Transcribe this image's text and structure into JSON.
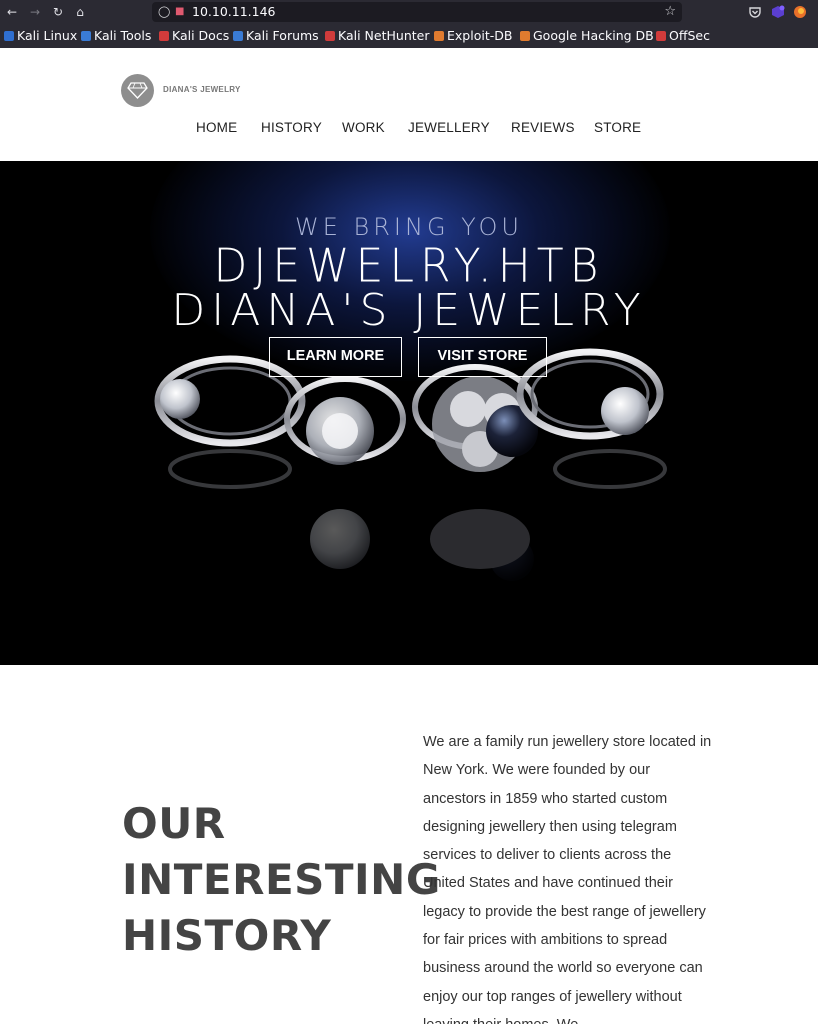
{
  "browser": {
    "url": "10.10.11.146",
    "bookmarks": [
      {
        "label": "Kali Linux",
        "color": "#2f6fd1"
      },
      {
        "label": "Kali Tools",
        "color": "#3a7bd5"
      },
      {
        "label": "Kali Docs",
        "color": "#d13b3b"
      },
      {
        "label": "Kali Forums",
        "color": "#3a7bd5"
      },
      {
        "label": "Kali NetHunter",
        "color": "#d13b3b"
      },
      {
        "label": "Exploit-DB",
        "color": "#e07b2f"
      },
      {
        "label": "Google Hacking DB",
        "color": "#e07b2f"
      },
      {
        "label": "OffSec",
        "color": "#d13b3b"
      }
    ]
  },
  "site": {
    "logo_text": "DIANA'S JEWELRY",
    "nav": [
      "HOME",
      "HISTORY",
      "WORK",
      "JEWELLERY",
      "REVIEWS",
      "STORE"
    ]
  },
  "hero": {
    "subtitle": "WE BRING YOU",
    "title_line1": "DJEWELRY.HTB",
    "title_line2": "DIANA'S JEWELRY",
    "learn_more": "LEARN MORE",
    "visit_store": "VISIT STORE"
  },
  "history": {
    "title_lines": [
      "OUR",
      "INTERESTING",
      "HISTORY"
    ],
    "text": "We are a family run jewellery store located in New York. We were founded by our ancestors in 1859 who started custom designing jewellery then using telegram services to deliver to clients across the United States and have continued their legacy to provide the best range of jewellery for fair prices with ambitions to spread business around the world so everyone can enjoy our top ranges of jewellery without leaving their homes. We"
  }
}
